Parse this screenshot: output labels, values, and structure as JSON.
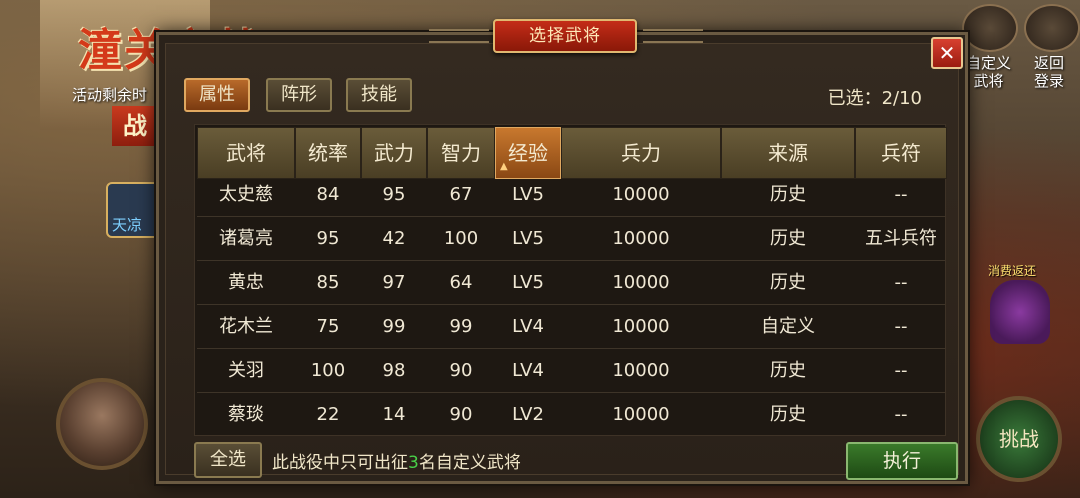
{
  "background": {
    "event_title": "潼关之战",
    "event_text": "活动剩余时",
    "battle_badge": "战",
    "tianliang": "天凉",
    "top_right": {
      "custom_general_label_1": "自定义",
      "custom_general_label_2": "武将",
      "back_label_1": "返回",
      "back_label_2": "登录"
    },
    "gift_label": "消费返还",
    "challenge_label": "挑战"
  },
  "dialog": {
    "title": "选择武将",
    "close_symbol": "✕",
    "tabs": [
      {
        "label": "属性",
        "active": true
      },
      {
        "label": "阵形",
        "active": false
      },
      {
        "label": "技能",
        "active": false
      }
    ],
    "selected_prefix": "已选：",
    "selected_value": "2/10",
    "columns": [
      "武将",
      "统率",
      "武力",
      "智力",
      "经验",
      "兵力",
      "来源",
      "兵符"
    ],
    "sorted_column": "经验",
    "rows": [
      {
        "name": "太史慈",
        "command": "84",
        "force": "95",
        "intellect": "67",
        "exp": "LV5",
        "troops": "10000",
        "source": "历史",
        "token": "--"
      },
      {
        "name": "诸葛亮",
        "command": "95",
        "force": "42",
        "intellect": "100",
        "exp": "LV5",
        "troops": "10000",
        "source": "历史",
        "token": "五斗兵符"
      },
      {
        "name": "黄忠",
        "command": "85",
        "force": "97",
        "intellect": "64",
        "exp": "LV5",
        "troops": "10000",
        "source": "历史",
        "token": "--"
      },
      {
        "name": "花木兰",
        "command": "75",
        "force": "99",
        "intellect": "99",
        "exp": "LV4",
        "troops": "10000",
        "source": "自定义",
        "token": "--"
      },
      {
        "name": "关羽",
        "command": "100",
        "force": "98",
        "intellect": "90",
        "exp": "LV4",
        "troops": "10000",
        "source": "历史",
        "token": "--"
      },
      {
        "name": "蔡琰",
        "command": "22",
        "force": "14",
        "intellect": "90",
        "exp": "LV2",
        "troops": "10000",
        "source": "历史",
        "token": "--"
      }
    ],
    "select_all_label": "全选",
    "footer_note_before": "此战役中只可出征",
    "footer_note_number": "3",
    "footer_note_after": "名自定义武将",
    "execute_label": "执行"
  }
}
